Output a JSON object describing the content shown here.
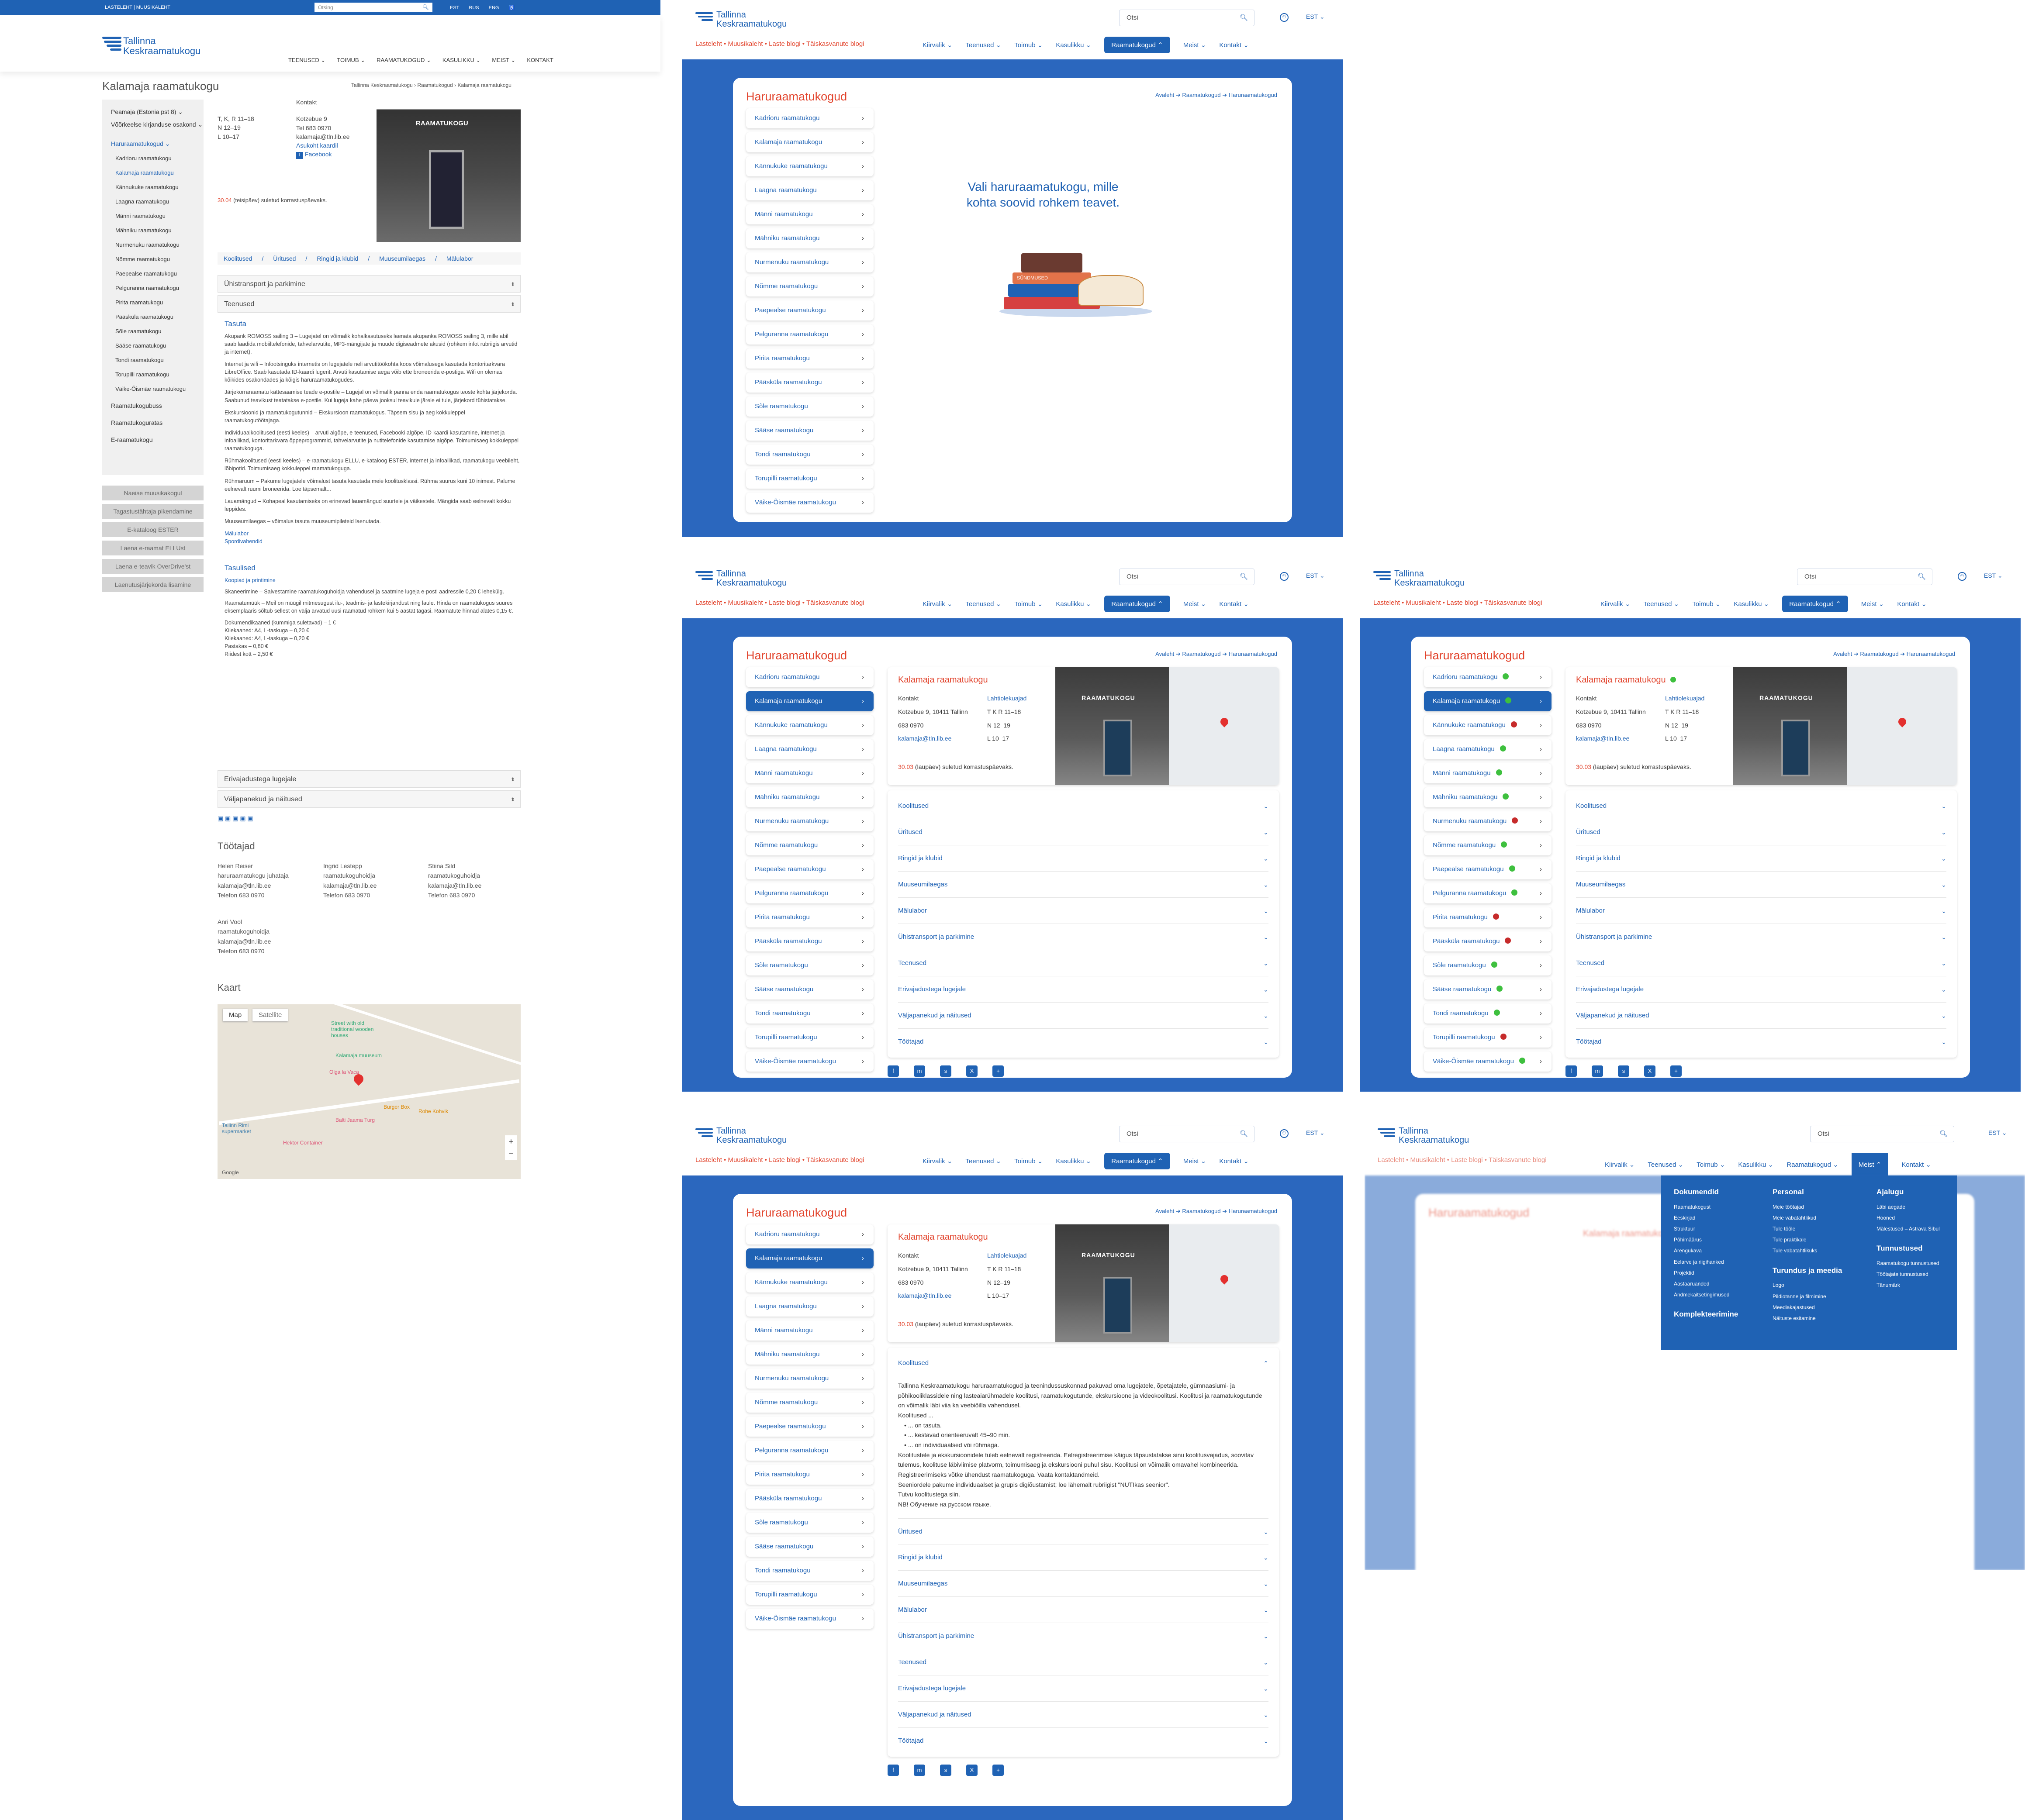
{
  "old": {
    "topbar": {
      "quicklinks": "LASTELEHT  |  MUUSIKALEHT",
      "search_placeholder": "Otsing",
      "langs": [
        "EST",
        "RUS",
        "ENG"
      ],
      "a11y": "♿"
    },
    "logo": {
      "line1": "Tallinna",
      "line2": "Keskraamatukogu"
    },
    "nav": [
      "TEENUSED ⌄",
      "TOIMUB ⌄",
      "RAAMATUKOGUD ⌄",
      "KASULIKKU ⌄",
      "MEIST ⌄",
      "KONTAKT"
    ],
    "page_title": "Kalamaja raamatukogu",
    "breadcrumb": "Tallinna Keskraamatukogu  ›  Raamatukogud  ›  Kalamaja raamatukogu",
    "sidebar": [
      "Peamaja (Estonia pst 8) ⌄",
      "Võõrkeelse kirjanduse osakond ⌄",
      "Haruraamatukogud ⌄",
      "Kadrioru raamatukogu",
      "Kalamaja raamatukogu",
      "Kännukuke raamatukogu",
      "Laagna raamatukogu",
      "Männi raamatukogu",
      "Mähniku raamatukogu",
      "Nurmenuku raamatukogu",
      "Nõmme raamatukogu",
      "Paepealse raamatukogu",
      "Pelguranna raamatukogu",
      "Pirita raamatukogu",
      "Pääsküla raamatukogu",
      "Sõle raamatukogu",
      "Sääse raamatukogu",
      "Tondi raamatukogu",
      "Torupilli raamatukogu",
      "Väike-Õismäe raamatukogu",
      "Raamatukogubuss",
      "Raamatukoguratas",
      "E-raamatukogu"
    ],
    "side_buttons": [
      "Naeise muusikakogul",
      "Tagastustähtaja pikendamine",
      "E-kataloog ESTER",
      "Laena e-raamat ELLUst",
      "Laena e-teavik OverDrive'st",
      "Laenutusjärjekorda lisamine"
    ],
    "hours": [
      "T, K, R 11–18",
      "N 12–19",
      "L 10–17"
    ],
    "contact": {
      "head": "Kontakt",
      "addr": "Kotzebue 9",
      "tel": "Tel 683 0970",
      "email": "kalamaja@tln.lib.ee",
      "map": "Asukoht kaardil",
      "fb": "Facebook"
    },
    "closed_note_date": "30.04",
    "closed_note": " (teisipäev) suletud korrastuspäevaks.",
    "photo_sign": "RAAMATUKOGU",
    "tabs": [
      "Koolitused",
      "/",
      "Üritused",
      "/",
      "Ringid ja klubid",
      "/",
      "Muuseumilaegas",
      "/",
      "Mälulabor"
    ],
    "acc1": "Ühistransport ja parkimine",
    "acc2": "Teenused",
    "acc3": "Erivajadustega lugejale",
    "acc4": "Väljapanekud ja näitused",
    "tasuta": "Tasuta",
    "services": [
      "Akupank ROMOSS sailing 3 – Lugejatel on võimalik kohalkasutuseks laenata akupanka ROMOSS sailing 3, mille abil saab laadida mobiiltelefonide, tahvelarvutite, MP3-mängijate ja muude digiseadmete akusid (rohkem infot rubriigis arvutid ja internet).",
      "Internet ja wifi – Infootsinguks internetis on lugejatele neli arvutitöökohta koos võimalusega kasutada kontoritarkvara LibreOffice. Saab kasutada ID-kaardi lugerit. Arvuti kasutamise aega võib ette broneerida e-postiga. Wifi on olemas kõikides osakondades ja kõigis haruraamatukogudes.",
      "Järjekorraraamatu kättesaamise teade e-postile – Lugejal on võimalik panna enda raamatukogus teoste kohta järjekorda. Saabunud teavikust teatatakse e-postile. Kui lugeja kahe päeva jooksul teavikule järele ei tule, järjekord tühistatakse.",
      "Ekskursioonid ja raamatukogutunnid – Ekskursioon raamatukogus. Täpsem sisu ja aeg kokkuleppel raamatukogutöötajaga.",
      "Individuaalkoolitused (eesti keeles) – arvuti algõpe, e-teenused, Facebooki algõpe, ID-kaardi kasutamine, internet ja infoallikad, kontoritarkvara õppeprogrammid, tahvelarvutite ja nutitelefonide kasutamise algõpe. Toimumisaeg kokkuleppel raamatukoguga.",
      "Rühmakoolitused (eesti keeles) – e-raamatukogu ELLU, e-kataloog ESTER, internet ja infoallikad, raamatukogu veebileht, lõbipotid. Toimumisaeg kokkuleppel raamatukoguga.",
      "Rühmaruum – Pakume lugejatele võimalust tasuta kasutada meie koolitusklassi. Rühma suurus kuni 10 inimest. Palume eelnevalt ruumi broneerida. Loe täpsemalt...",
      "Lauamängud – Kohapeal kasutamiseks on erinevad lauamängud suurtele ja väikestele. Mängida saab eelnevalt kokku leppides.",
      "Muuseumilaegas – võimalus tasuta muuseumipileteid laenutada."
    ],
    "mall": "Mälulabor",
    "sport": "Spordivahendid",
    "tasulised": "Tasulised",
    "paid_link": "Koopiad ja printimine",
    "paid": [
      "Skaneerimine – Salvestamine raamatukoguhoidja vahendusel ja saatmine lugeja e-posti aadressile 0,20 € lehekülg.",
      "Raamatumüük – Meil on müügil mitmesugust ilu-, teadmis- ja lastekirjandust ning laule. Hinda on raamatukogus suures eksemplaaris sõltub sellest on välja arvatud uusi raamatud rohkem kui 5 aastat tagasi. Raamatute hinnad alates 0,15 €.",
      "Dokumendikaaned (kummiga suletavad) – 1 €",
      "Kilekaaned: A4, L-taskuga – 0,20 €",
      "Kilekaaned: A4, L-taskuga – 0,20 €",
      "Pastakas – 0,80 €",
      "Riidest kott – 2,50 €"
    ],
    "staff_title": "Töötajad",
    "staff": [
      [
        "Helen Reiser",
        "haruraamatukogu juhataja",
        "kalamaja@tln.lib.ee",
        "Telefon 683 0970"
      ],
      [
        "Ingrid Lestepp",
        "raamatukoguhoidja",
        "kalamaja@tln.lib.ee",
        "Telefon 683 0970"
      ],
      [
        "Stiina Sild",
        "raamatukoguhoidja",
        "kalamaja@tln.lib.ee",
        "Telefon 683 0970"
      ],
      [
        "Anri Vool",
        "raamatukoguhoidja",
        "kalamaja@tln.lib.ee",
        "Telefon 683 0970"
      ]
    ],
    "map_title": "Kaart",
    "map_tabs": [
      "Map",
      "Satellite"
    ],
    "map_labels": [
      "Kalamaja muuseum",
      "Olga la Vaca",
      "Burger Box",
      "Balti Jaama Turg",
      "Hektor Container",
      "Rohe Kohvik",
      "Tallinn Rimi supermarket",
      "Street with old traditional wooden houses",
      "Google"
    ]
  },
  "new": {
    "logo": {
      "line1": "Tallinna",
      "line2": "Keskraamatukogu"
    },
    "search_placeholder": "Otsi",
    "lang": "EST ⌄",
    "blogs": "Lasteleht • Muusikaleht • Laste blogi • Täiskasvanute blogi",
    "nav": [
      "Kiirvalik ⌄",
      "Teenused ⌄",
      "Toimub ⌄",
      "Kasulikku ⌄",
      "Raamatukogud ⌃",
      "Meist ⌄",
      "Kontakt ⌄"
    ],
    "nav_meist_open": [
      "Kiirvalik ⌄",
      "Teenused ⌄",
      "Toimub ⌄",
      "Kasulikku ⌄",
      "Raamatukogud ⌄",
      "Meist ⌃",
      "Kontakt ⌄"
    ],
    "title": "Haruraamatukogud",
    "breadcrumb": "Avaleht  ➔  Raamatukogud  ➔  Haruraamatukogud",
    "libraries": [
      "Kadrioru raamatukogu",
      "Kalamaja raamatukogu",
      "Kännukuke raamatukogu",
      "Laagna raamatukogu",
      "Männi raamatukogu",
      "Mähniku raamatukogu",
      "Nurmenuku raamatukogu",
      "Nõmme raamatukogu",
      "Paepealse raamatukogu",
      "Pelguranna raamatukogu",
      "Pirita raamatukogu",
      "Pääsküla raamatukogu",
      "Sõle raamatukogu",
      "Sääse raamatukogu",
      "Tondi raamatukogu",
      "Torupilli raamatukogu",
      "Väike-Õismäe raamatukogu"
    ],
    "status": [
      "g",
      "g",
      "r",
      "g",
      "g",
      "g",
      "r",
      "g",
      "g",
      "g",
      "r",
      "r",
      "g",
      "g",
      "g",
      "r",
      "g"
    ],
    "status_colors": {
      "open": "#3ec03e",
      "closed": "#c62b2b"
    },
    "empty_prompt": "Vali haruraamatukogu, mille kohta soovid rohkem teavet.",
    "book_label": "SÜNDMUSED",
    "lib": {
      "name": "Kalamaja raamatukogu",
      "contact_head": "Kontakt",
      "addr": "Kotzebue 9, 10411 Tallinn",
      "tel": "683 0970",
      "email": "kalamaja@tln.lib.ee",
      "hours_head": "Lahtiolekuajad",
      "hours": [
        "T  K  R  11–18",
        "N  12–19",
        "L  10–17"
      ],
      "note_date": "30.03",
      "note": " (laupäev) suletud korrastuspäevaks.",
      "sign": "RAAMATUKOGU"
    },
    "accordions": [
      "Koolitused",
      "Üritused",
      "Ringid ja klubid",
      "Muuseumilaegas",
      "Mälulabor",
      "Ühistransport ja parkimine",
      "Teenused",
      "Erivajadustega lugejale",
      "Väljapanekud ja näitused",
      "Töötajad"
    ],
    "share": [
      "f",
      "m",
      "s",
      "X",
      "+"
    ],
    "koolitused_text": [
      "Tallinna Keskraamatukogu haruraamatukogud ja teenindussuskonnad pakuvad oma lugejatele, õpetajatele, gümnaasiumi- ja põhikooliklassidele ning lasteaiarühmadele koolitusi, raamatukogutunde, ekskursioone ja videokoolitusi. Koolitusi ja raamatukogutunde on võimalik läbi viia ka veebiõilla vahendusel.",
      "Koolitused ...",
      "• ... on tasuta.",
      "• ... kestavad orienteeruvalt 45–90 min.",
      "• ... on individuaalsed või rühmaga.",
      "Koolitustele ja ekskursioonidele tuleb eelnevalt registreerida. Eelregistreerimise käigus täpsustatakse sinu koolitusvajadus, soovitav tulemus, koolituse läbiviimise platvorm, toimumisaeg ja ekskursiooni puhul sisu. Koolitusi on võimalik omavahel kombineerida.",
      "Registreerimiseks võtke ühendust raamatukoguga. Vaata kontaktandmeid.",
      "Seeniordele pakume individuaalset ja grupis digiõustamist; loe lähemalt rubriigist \"NUTIkas seenior\".",
      "Tutvu koolitustega siin.",
      "NB! Обучение на русском языке."
    ],
    "mega": {
      "c1h": "Dokumendid",
      "c1": [
        "Raamatukogust",
        "Eeskirjad",
        "Struktuur",
        "Põhimäärus",
        "Arengukava",
        "Eelarve ja riigihanked",
        "Projektid",
        "Aastaaruanded",
        "Andmekaitsetingimused"
      ],
      "c1h2": "Komplekteerimine",
      "c2h": "Personal",
      "c2": [
        "Meie töötajad",
        "Meie vabatahtlikud",
        "Tule tööle",
        "Tule praktikale",
        "Tule vabatahtlikuks"
      ],
      "c2h2": "Turundus ja meedia",
      "c2b": [
        "Logo",
        "Pildiotanne ja filmimine",
        "Meediakajastused",
        "Näituste esitamine"
      ],
      "c3h": "Ajalugu",
      "c3": [
        "Läbi aegade",
        "Hooned",
        "Mälestused – Astrava Sibul"
      ],
      "c3h2": "Tunnustused",
      "c3b": [
        "Raamatukogu tunnustused",
        "Töötajate tunnustused",
        "Tänumärk"
      ]
    }
  }
}
